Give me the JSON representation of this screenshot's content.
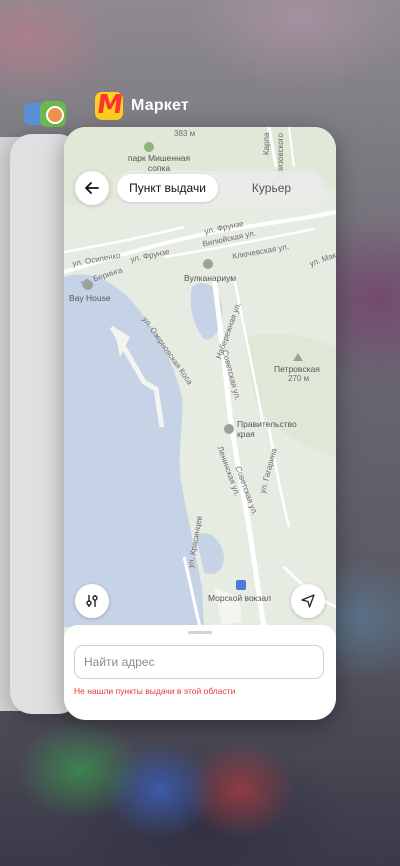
{
  "app_switcher": {
    "app_name": "Маркет",
    "app_logo_letter": "М"
  },
  "map": {
    "labels": {
      "altitude_top": "383 м",
      "mishennaya": "парк Мишенная\nсопка",
      "karla": "Карла",
      "elizovo": "Елизовского",
      "frunze_1": "ул. Фрунзе",
      "vilyuyskaya": "Вилюйская ул.",
      "klyuchevskaya": "Ключевская ул.",
      "osipenko": "ул. Осипенко",
      "frunze_2": "ул. Фрунзе",
      "makarova": "ул. Мак",
      "bering": "ул. Беринга",
      "vulkanarium": "Вулканариум",
      "bay_house": "Bay House",
      "ozernovskaya": "ул. Озерновская Коса",
      "naberezhnaya": "Набережная ул.",
      "sovetskaya_1": "Советская ул.",
      "petrovskaya": "Петровская",
      "petrovskaya_alt": "270 м",
      "pravitelstvo": "Правительство\nкрая",
      "gagarina": "ул. Гагарина",
      "leninskaya": "Ленинская ул.",
      "sovetskaya_2": "Советская ул.",
      "krasintsev": "ул. Красинцев",
      "morskoy_vokzal": "Морской вокзал"
    }
  },
  "toolbar": {
    "tab_pickup": "Пункт выдачи",
    "tab_courier": "Курьер"
  },
  "sheet": {
    "address_placeholder": "Найти адрес",
    "error_message": "Не нашли пункты выдачи в этой области"
  },
  "colors": {
    "error": "#e53935",
    "logo_bg": "#ffd21e",
    "logo_fg": "#ff3333",
    "water": "#c6d3e6",
    "land": "#e7ece2"
  }
}
